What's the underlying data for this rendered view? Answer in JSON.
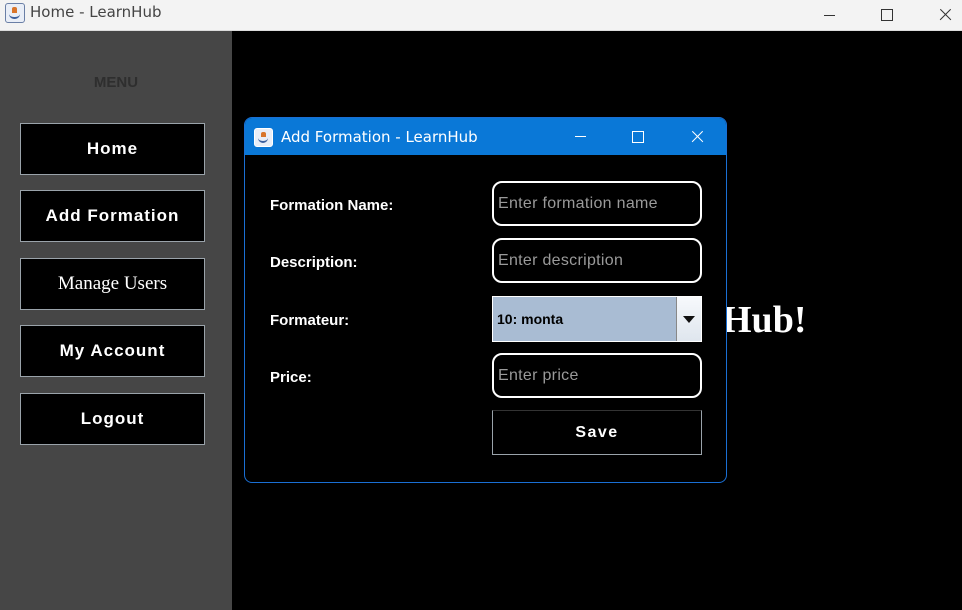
{
  "window": {
    "title": "Home - LearnHub"
  },
  "sidebar": {
    "menu_label": "MENU",
    "items": [
      {
        "label": "Home"
      },
      {
        "label": "Add Formation"
      },
      {
        "label": "Manage Users"
      },
      {
        "label": "My Account"
      },
      {
        "label": "Logout"
      }
    ]
  },
  "main": {
    "welcome_fragment": "Hub!"
  },
  "dialog": {
    "title": "Add Formation - LearnHub",
    "fields": {
      "name": {
        "label": "Formation Name:",
        "placeholder": "Enter formation name",
        "value": ""
      },
      "description": {
        "label": "Description:",
        "placeholder": "Enter description",
        "value": ""
      },
      "formateur": {
        "label": "Formateur:",
        "selected": "10: monta"
      },
      "price": {
        "label": "Price:",
        "placeholder": "Enter price",
        "value": ""
      }
    },
    "save_label": "Save"
  },
  "colors": {
    "dialog_titlebar": "#0a78d7",
    "sidebar_bg": "#464646",
    "combo_bg": "#a9bcd3"
  }
}
